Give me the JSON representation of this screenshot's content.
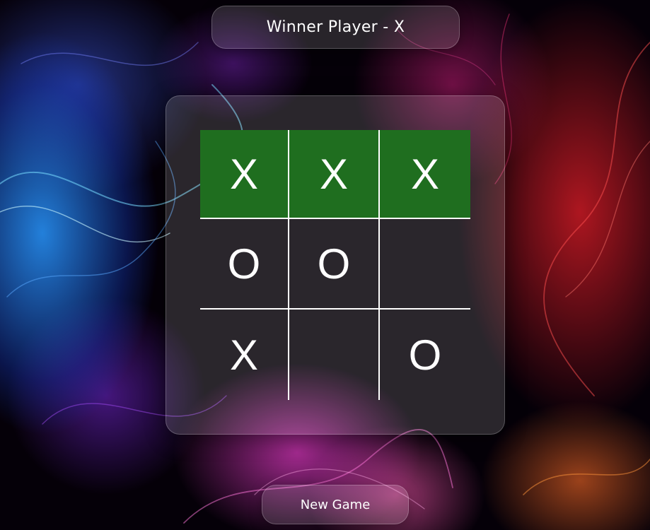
{
  "status": {
    "winner_text": "Winner Player - X"
  },
  "board": {
    "cells": [
      "X",
      "X",
      "X",
      "O",
      "O",
      "",
      "X",
      "",
      "O"
    ],
    "winning_cells": [
      0,
      1,
      2
    ],
    "win_color": "#1f6e1f"
  },
  "actions": {
    "new_game_label": "New Game"
  }
}
